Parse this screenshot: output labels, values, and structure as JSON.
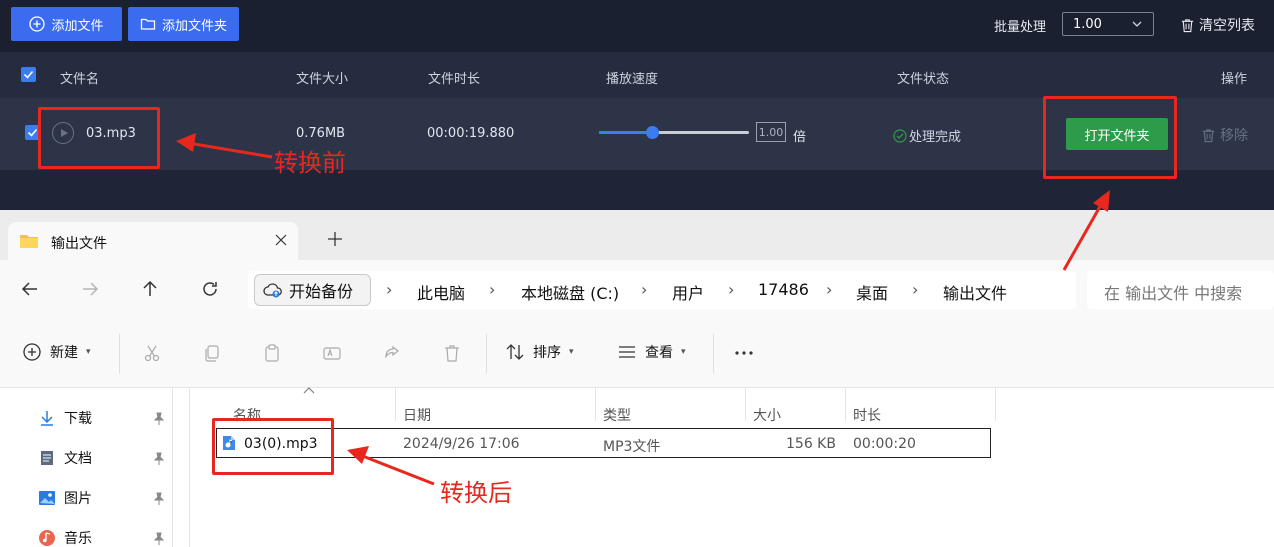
{
  "toolbar_top": {
    "add_file": "添加文件",
    "add_folder": "添加文件夹",
    "batch_label": "批量处理",
    "batch_value": "1.00",
    "clear_list": "清空列表"
  },
  "table_header": {
    "name": "文件名",
    "size": "文件大小",
    "duration": "文件时长",
    "speed": "播放速度",
    "status": "文件状态",
    "actions": "操作"
  },
  "file_row": {
    "name": "03.mp3",
    "size": "0.76MB",
    "duration": "00:00:19.880",
    "speed_value": "1.00",
    "speed_unit": "倍",
    "speed_fraction": 0.35,
    "status": "处理完成",
    "open_folder": "打开文件夹",
    "remove": "移除"
  },
  "annotations": {
    "before": "转换前",
    "after": "转换后",
    "color": "#e8271e"
  },
  "explorer": {
    "tab_title": "输出文件",
    "backup": "开始备份",
    "breadcrumbs": [
      "此电脑",
      "本地磁盘 (C:)",
      "用户",
      "17486",
      "桌面",
      "输出文件"
    ],
    "search_placeholder": "在 输出文件 中搜索",
    "toolbar": {
      "new": "新建",
      "sort": "排序",
      "view": "查看"
    },
    "nav": [
      "下载",
      "文档",
      "图片",
      "音乐"
    ],
    "columns": [
      "名称",
      "日期",
      "类型",
      "大小",
      "时长"
    ],
    "file": {
      "name": "03(0).mp3",
      "date": "2024/9/26 17:06",
      "type": "MP3文件",
      "size": "156 KB",
      "duration": "00:00:20"
    }
  },
  "colors": {
    "app_bg": "#1f2537",
    "accent_blue": "#3b6cf0",
    "accent_green": "#2e9b4a"
  }
}
